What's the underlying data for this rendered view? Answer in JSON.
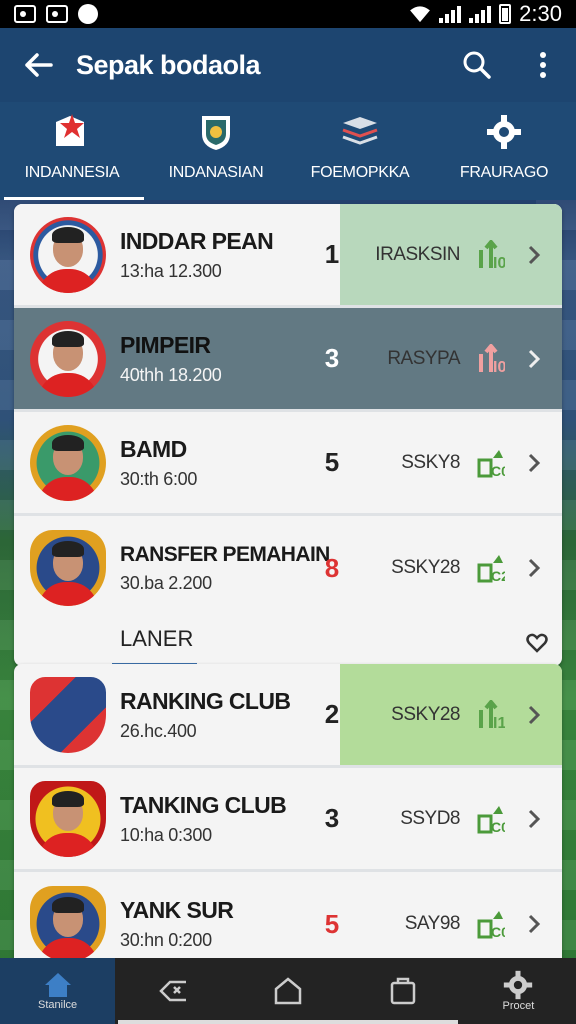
{
  "status_bar": {
    "time": "2:30"
  },
  "app_bar": {
    "title": "Sepak bodaola"
  },
  "tabs": [
    {
      "label": "INDANNESIA",
      "icon": "star-flag-icon",
      "active": true
    },
    {
      "label": "INDANASIAN",
      "icon": "shield-badge-icon",
      "active": false
    },
    {
      "label": "FOEMOPKKA",
      "icon": "layers-icon",
      "active": false
    },
    {
      "label": "FRAURAGO",
      "icon": "gear-icon",
      "active": false
    }
  ],
  "card1": {
    "rows": [
      {
        "name": "INDDAR PEAN",
        "sub": "13:ha 12.300",
        "num": "1",
        "code": "IRASKSIN",
        "arrow": "I0"
      },
      {
        "name": "PIMPEIR",
        "sub": "40thh 18.200",
        "num": "3",
        "code": "RASYPA",
        "arrow": "I0"
      },
      {
        "name": "BAMD",
        "sub": "30:th 6:00",
        "num": "5",
        "code": "SSKY8",
        "arrow": "C0"
      },
      {
        "name": "RANSFER PEMAHAIN",
        "sub": "30.ba 2.200",
        "num": "8",
        "code": "SSKY28",
        "arrow": "C2"
      }
    ],
    "footer_label": "LANER"
  },
  "card2": {
    "rows": [
      {
        "name": "RANKING CLUB",
        "sub": "26.hc.400",
        "num": "2",
        "code": "SSKY28",
        "arrow": "I1"
      },
      {
        "name": "TANKING CLUB",
        "sub": "10:ha 0:300",
        "num": "3",
        "code": "SSYD8",
        "arrow": "C0"
      },
      {
        "name": "YANK SUR",
        "sub": "30:hn 0:200",
        "num": "5",
        "code": "SAY98",
        "arrow": "C0"
      }
    ]
  },
  "bottom_nav": [
    {
      "label": "Stanilce",
      "icon": "home-icon"
    },
    {
      "label": "",
      "icon": "back-icon"
    },
    {
      "label": "",
      "icon": "home-outline-icon"
    },
    {
      "label": "",
      "icon": "recent-apps-icon"
    },
    {
      "label": "Procet",
      "icon": "gear-icon"
    }
  ],
  "colors": {
    "appbar": "#1d4570",
    "highlight_green": "#b8d8bc",
    "highlight_dark": "#627983",
    "accent_red": "#d33"
  }
}
